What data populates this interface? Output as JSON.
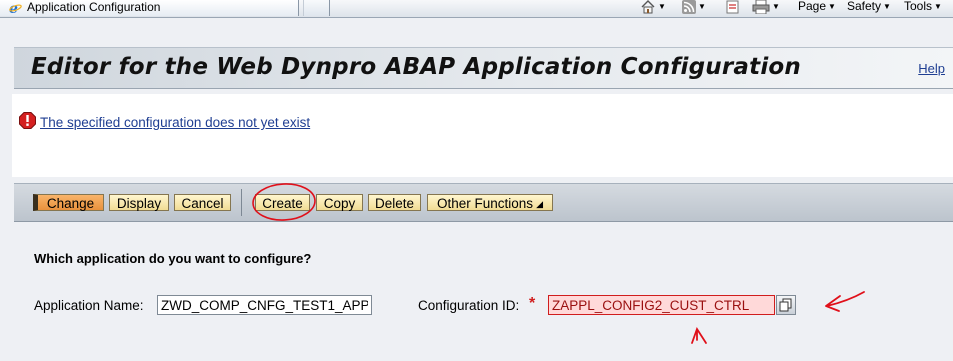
{
  "browser": {
    "tab_title": "Application Configuration",
    "tools": {
      "page_label": "Page",
      "safety_label": "Safety",
      "tools_label": "Tools"
    }
  },
  "header": {
    "title": "Editor for the Web Dynpro ABAP Application Configuration",
    "help_label": "Help"
  },
  "message": {
    "text": "The specified configuration does not yet exist",
    "type": "error"
  },
  "toolbar": {
    "buttons": [
      {
        "label": "Change",
        "state": "active"
      },
      {
        "label": "Display"
      },
      {
        "label": "Cancel"
      },
      {
        "label": "Create"
      },
      {
        "label": "Copy"
      },
      {
        "label": "Delete"
      },
      {
        "label": "Other Functions"
      }
    ]
  },
  "form": {
    "question": "Which application do you want to configure?",
    "application_name": {
      "label": "Application Name:",
      "value": "ZWD_COMP_CNFG_TEST1_APP"
    },
    "configuration_id": {
      "label": "Configuration ID:",
      "required_marker": "*",
      "value": "ZAPPL_CONFIG2_CUST_CTRL",
      "state": "error"
    }
  },
  "colors": {
    "accent_link": "#1f3e92",
    "button_fill": "#f1dc94",
    "active_button_fill": "#e8913c",
    "error_red": "#d01d1d",
    "annotation_red": "#e0101a"
  }
}
